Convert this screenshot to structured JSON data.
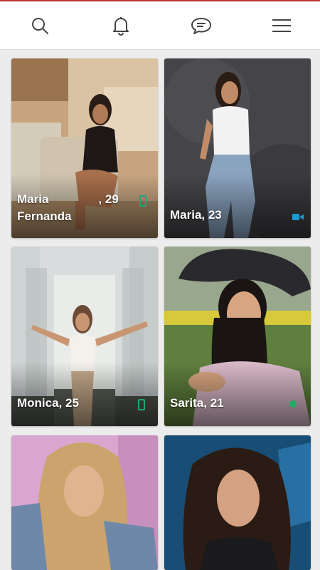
{
  "nav": {
    "icons": [
      "search-icon",
      "bell-icon",
      "chat-icon",
      "menu-icon"
    ],
    "accent": "#b8342f"
  },
  "cards": [
    {
      "name_line1": "Maria",
      "name_line2": "Fernanda",
      "age_text": ", 29",
      "status": "phone-icon"
    },
    {
      "label": "Maria, 23",
      "status": "video-icon"
    },
    {
      "label": "Monica, 25",
      "status": "phone-icon"
    },
    {
      "label": "Sarita, 21",
      "status": "online-dot"
    },
    {
      "label": "",
      "status": ""
    },
    {
      "label": "",
      "status": ""
    }
  ],
  "colors": {
    "status_green": "#1ea67a",
    "video_teal": "#1b9bd1",
    "online_green": "#1fae63"
  }
}
